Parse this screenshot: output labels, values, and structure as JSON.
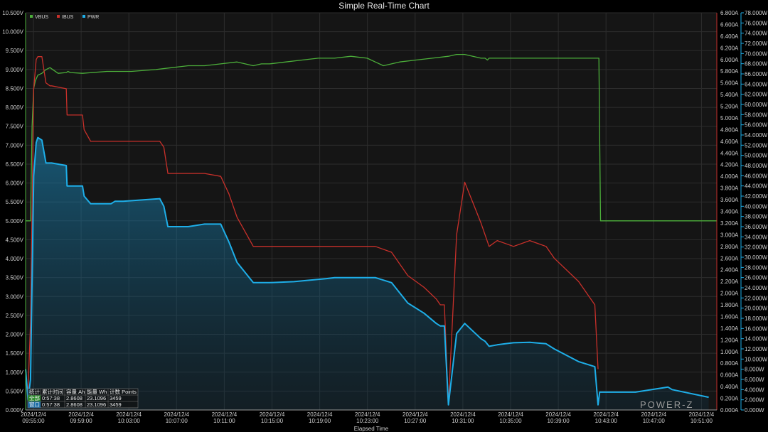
{
  "chart_data": {
    "type": "line",
    "title": "Simple Real-Time Chart",
    "xlabel": "Elapsed Time",
    "x_ticks": [
      [
        "2024/12/4",
        "09:55:00"
      ],
      [
        "2024/12/4",
        "09:59:00"
      ],
      [
        "2024/12/4",
        "10:03:00"
      ],
      [
        "2024/12/4",
        "10:07:00"
      ],
      [
        "2024/12/4",
        "10:11:00"
      ],
      [
        "2024/12/4",
        "10:15:00"
      ],
      [
        "2024/12/4",
        "10:19:00"
      ],
      [
        "2024/12/4",
        "10:23:00"
      ],
      [
        "2024/12/4",
        "10:27:00"
      ],
      [
        "2024/12/4",
        "10:31:00"
      ],
      [
        "2024/12/4",
        "10:35:00"
      ],
      [
        "2024/12/4",
        "10:39:00"
      ],
      [
        "2024/12/4",
        "10:43:00"
      ],
      [
        "2024/12/4",
        "10:47:00"
      ],
      [
        "2024/12/4",
        "10:51:00"
      ]
    ],
    "x_range_minutes": [
      0,
      56.5
    ],
    "y_left": {
      "range": [
        0,
        10.5
      ],
      "step": 0.5,
      "unit": "V",
      "decimals": 3
    },
    "y_right1": {
      "range": [
        0,
        6.8
      ],
      "step": 0.2,
      "unit": "A",
      "decimals": 3
    },
    "y_right2": {
      "range": [
        0,
        78
      ],
      "step": 2,
      "unit": "W",
      "decimals": 3
    },
    "grid": true,
    "legend_position": "top-left",
    "series": [
      {
        "name": "VBUS",
        "axis": "left",
        "color": "#4caf3a",
        "x": [
          0,
          0.6,
          0.8,
          1.0,
          1.2,
          1.5,
          2.0,
          2.5,
          3.0,
          4.0,
          5.0,
          5.2,
          5.5,
          7.0,
          10.0,
          13.0,
          16.0,
          18.0,
          20.0,
          22.0,
          24.0,
          26.0,
          28.0,
          29.0,
          30.0,
          32.0,
          34.0,
          36.0,
          38.0,
          40.0,
          42.0,
          43.0,
          44.0,
          46.0,
          48.0,
          50.0,
          52.0,
          53.0,
          54.0,
          56.0,
          56.5,
          56.8,
          57.0,
          58.0,
          59.0,
          63.0,
          67.0,
          70.5,
          70.7,
          71.0,
          76.0,
          80.0,
          85.0
        ],
        "y": [
          5.0,
          5.0,
          7.5,
          8.5,
          8.7,
          8.85,
          8.9,
          9.0,
          9.05,
          8.9,
          8.92,
          8.95,
          8.92,
          8.9,
          8.95,
          8.95,
          9.0,
          9.05,
          9.1,
          9.1,
          9.15,
          9.2,
          9.1,
          9.15,
          9.15,
          9.2,
          9.25,
          9.3,
          9.3,
          9.35,
          9.3,
          9.2,
          9.1,
          9.2,
          9.25,
          9.3,
          9.35,
          9.4,
          9.4,
          9.3,
          9.3,
          9.25,
          9.3,
          9.3,
          9.3,
          9.3,
          9.3,
          9.3,
          5.0,
          5.0,
          5.0,
          5.0,
          5.0
        ]
      },
      {
        "name": "IBUS",
        "axis": "right1",
        "color": "#c8302a",
        "x": [
          0,
          0.3,
          0.6,
          1.0,
          1.3,
          1.5,
          2.0,
          2.5,
          3.0,
          3.2,
          5.0,
          5.1,
          7.0,
          7.2,
          8.0,
          10.5,
          11.0,
          12.0,
          16.5,
          17.0,
          17.5,
          20.0,
          22.0,
          24.0,
          25.0,
          26.0,
          28.0,
          30.0,
          33.0,
          35.0,
          37.0,
          38.0,
          40.0,
          43.0,
          45.0,
          47.0,
          49.0,
          50.5,
          51.0,
          51.5,
          52.0,
          53.0,
          54.0,
          56.0,
          56.5,
          57.0,
          58.0,
          59.0,
          60.0,
          62.0,
          64.0,
          65.0,
          68.0,
          70.0,
          70.4
        ],
        "y": [
          0.5,
          0.3,
          1.5,
          5.5,
          6.0,
          6.05,
          6.05,
          5.6,
          5.55,
          5.55,
          5.5,
          5.05,
          5.05,
          4.8,
          4.6,
          4.6,
          4.6,
          4.6,
          4.6,
          4.5,
          4.05,
          4.05,
          4.05,
          4.0,
          3.7,
          3.3,
          2.8,
          2.8,
          2.8,
          2.8,
          2.8,
          2.8,
          2.8,
          2.8,
          2.7,
          2.3,
          2.1,
          1.9,
          1.8,
          1.8,
          0.1,
          3.0,
          3.9,
          3.2,
          3.0,
          2.8,
          2.9,
          2.85,
          2.8,
          2.9,
          2.8,
          2.6,
          2.2,
          1.8,
          0.7
        ]
      },
      {
        "name": "PWR",
        "axis": "right2",
        "color": "#1eaee8",
        "x": [
          0,
          0.3,
          0.6,
          1.0,
          1.3,
          1.5,
          2.0,
          2.5,
          3.0,
          3.2,
          5.0,
          5.1,
          7.0,
          7.2,
          8.0,
          10.5,
          11.0,
          12.0,
          16.5,
          17.0,
          17.5,
          20.0,
          22.0,
          24.0,
          25.0,
          26.0,
          28.0,
          30.0,
          33.0,
          35.0,
          37.0,
          38.0,
          40.0,
          43.0,
          45.0,
          47.0,
          49.0,
          50.5,
          51.0,
          51.5,
          52.0,
          53.0,
          54.0,
          56.0,
          56.5,
          57.0,
          58.0,
          59.0,
          60.0,
          62.0,
          64.0,
          65.0,
          68.0,
          70.0,
          70.4,
          70.6,
          71.0,
          75.0,
          79.0,
          79.5,
          84.0
        ],
        "y": [
          8.0,
          2.0,
          6.0,
          46.0,
          52.5,
          53.5,
          53.0,
          48.5,
          48.5,
          48.5,
          48.0,
          44.0,
          44.0,
          42.0,
          40.5,
          40.5,
          41.0,
          41.0,
          41.5,
          40.0,
          36.0,
          36.0,
          36.5,
          36.5,
          33.0,
          29.0,
          25.0,
          25.0,
          25.2,
          25.5,
          25.8,
          26.0,
          26.0,
          26.0,
          25.0,
          21.0,
          19.0,
          17.0,
          16.5,
          16.5,
          1.0,
          15.0,
          17.0,
          14.0,
          13.5,
          12.5,
          12.8,
          13.0,
          13.2,
          13.3,
          13.0,
          12.0,
          9.5,
          8.5,
          1.0,
          3.5,
          3.5,
          3.5,
          4.5,
          4.0,
          2.5
        ]
      }
    ],
    "stats_table": {
      "headers": [
        "统计",
        "累计时间",
        "容量 Ah",
        "能量 Wh",
        "计数 Points"
      ],
      "rows": [
        [
          "全部",
          "0:57:38",
          "2.8608",
          "23.1096",
          "3459"
        ],
        [
          "窗口",
          "0:57:38",
          "2.8608",
          "23.1096",
          "3459"
        ]
      ]
    },
    "watermark": "POWER-Z",
    "colors": {
      "background": "#000000",
      "plot_bg": "#151515",
      "grid": "#2d2d2d",
      "axis": "#9a9a9a"
    }
  }
}
